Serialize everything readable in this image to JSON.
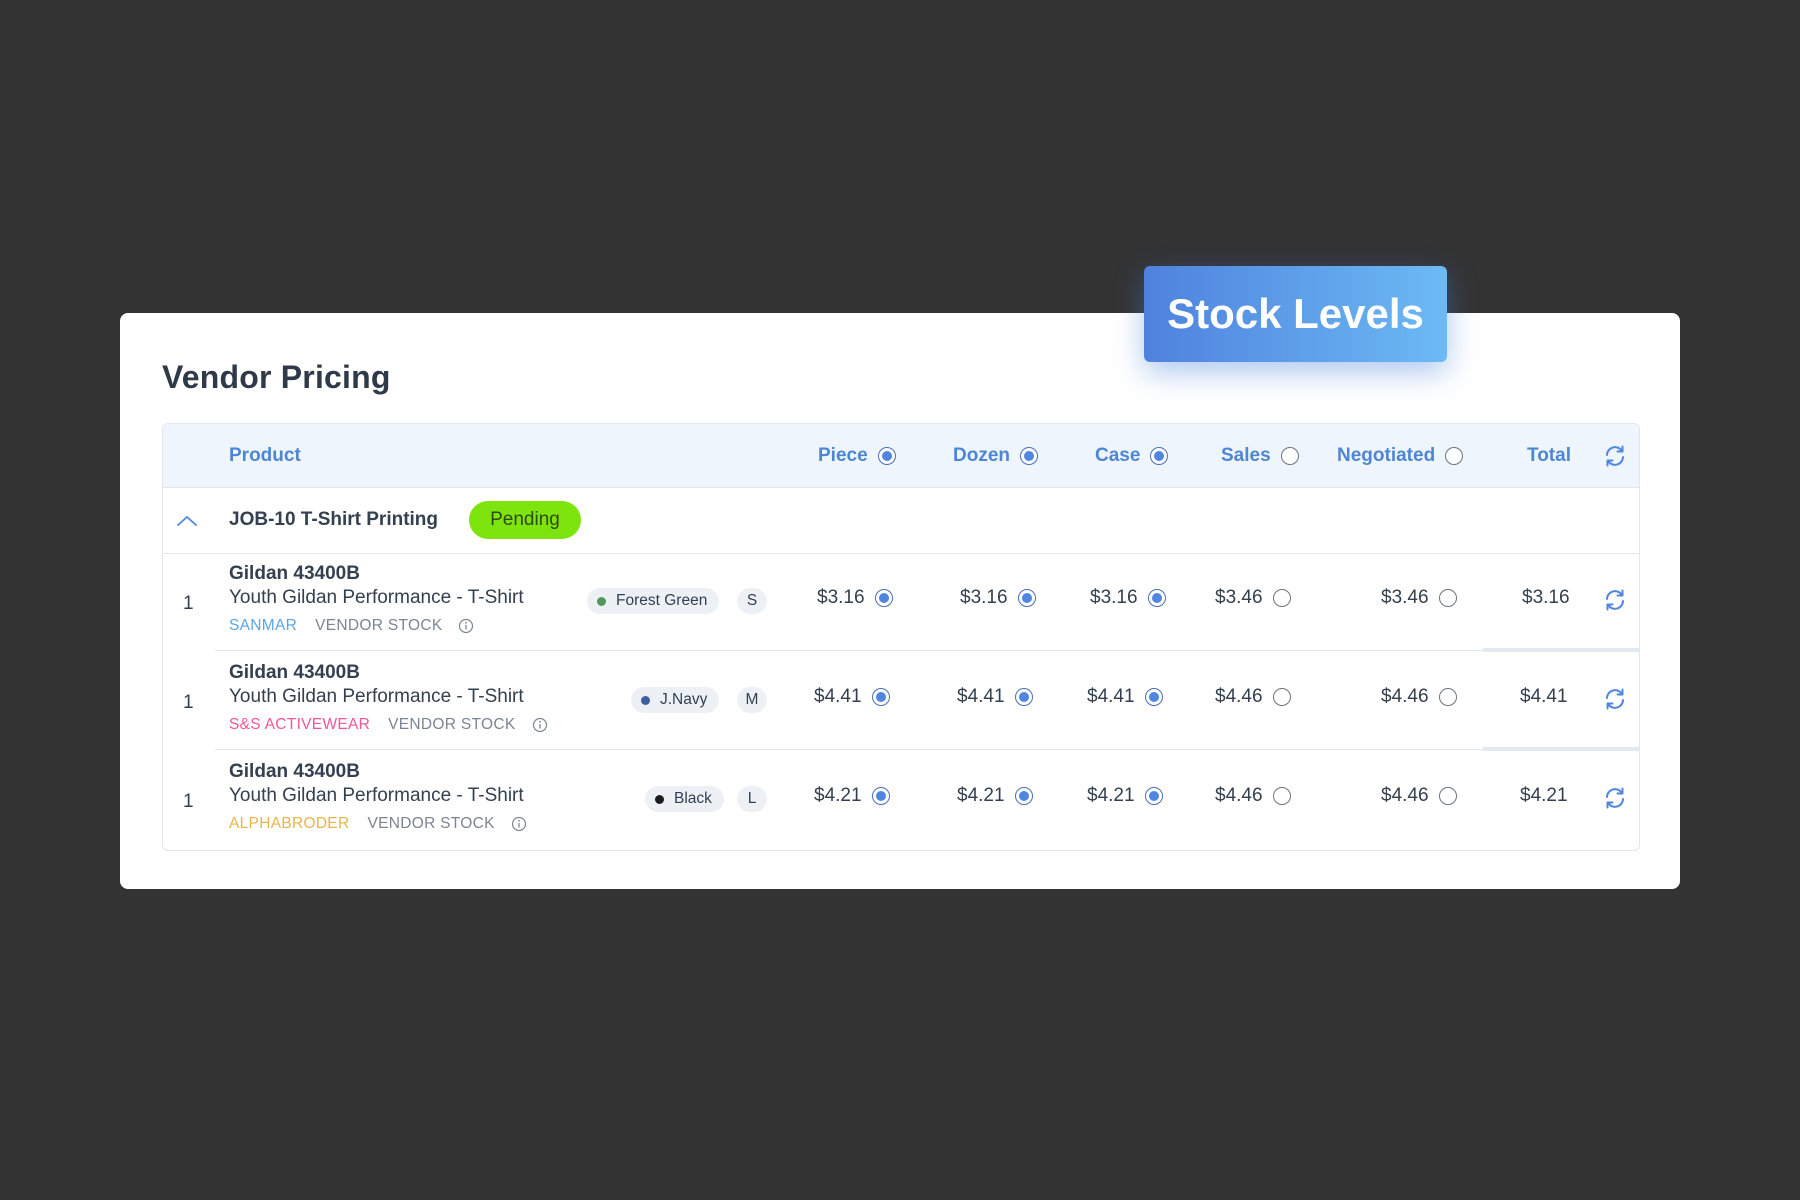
{
  "badge": {
    "label": "Stock Levels"
  },
  "page": {
    "title": "Vendor Pricing"
  },
  "table": {
    "headers": {
      "product": "Product",
      "piece": "Piece",
      "dozen": "Dozen",
      "case": "Case",
      "sales": "Sales",
      "negotiated": "Negotiated",
      "total": "Total"
    },
    "header_selection": {
      "piece": true,
      "dozen": true,
      "case": true,
      "sales": false,
      "negotiated": false
    },
    "group": {
      "label": "JOB-10 T-Shirt Printing",
      "status": "Pending",
      "status_color": "#7ee40e"
    },
    "rows": [
      {
        "index": "1",
        "name": "Gildan 43400B",
        "description": "Youth Gildan Performance - T-Shirt",
        "vendor": "SANMAR",
        "vendor_color": "#5aa6e6",
        "stock_label": "VENDOR STOCK",
        "color": "Forest Green",
        "color_dot": "#4f9a5a",
        "size": "S",
        "piece": "$3.16",
        "dozen": "$3.16",
        "case": "$3.16",
        "sales": "$3.46",
        "negotiated": "$3.46",
        "total": "$3.16"
      },
      {
        "index": "1",
        "name": "Gildan 43400B",
        "description": "Youth Gildan Performance - T-Shirt",
        "vendor": "S&S ACTIVEWEAR",
        "vendor_color": "#f0569a",
        "stock_label": "VENDOR STOCK",
        "color": "J.Navy",
        "color_dot": "#3e5f9e",
        "size": "M",
        "piece": "$4.41",
        "dozen": "$4.41",
        "case": "$4.41",
        "sales": "$4.46",
        "negotiated": "$4.46",
        "total": "$4.41"
      },
      {
        "index": "1",
        "name": "Gildan 43400B",
        "description": "Youth Gildan Performance - T-Shirt",
        "vendor": "ALPHABRODER",
        "vendor_color": "#e8b54a",
        "stock_label": "VENDOR STOCK",
        "color": "Black",
        "color_dot": "#1c1c1c",
        "size": "L",
        "piece": "$4.21",
        "dozen": "$4.21",
        "case": "$4.21",
        "sales": "$4.46",
        "negotiated": "$4.46",
        "total": "$4.21"
      }
    ]
  },
  "icons": {
    "refresh": "refresh-icon",
    "collapse": "chevron-up-icon",
    "info": "info-icon"
  }
}
